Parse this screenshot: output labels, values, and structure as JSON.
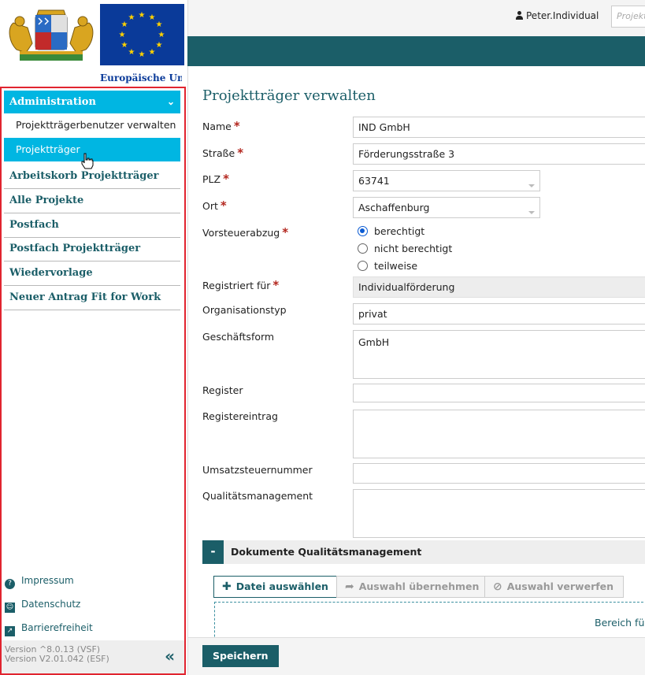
{
  "logos": {
    "eu_label": "Europäische Uni"
  },
  "sidebar": {
    "section_title": "Administration",
    "sub_items": [
      {
        "label": "Projektträgerbenutzer verwalten"
      },
      {
        "label": "Projektträger",
        "active": true
      }
    ],
    "items": [
      {
        "label": "Arbeitskorb Projektträger"
      },
      {
        "label": "Alle Projekte"
      },
      {
        "label": "Postfach"
      },
      {
        "label": "Postfach Projektträger"
      },
      {
        "label": "Wiedervorlage"
      },
      {
        "label": "Neuer Antrag Fit for Work"
      }
    ],
    "footer_links": [
      {
        "label": "Impressum",
        "icon": "question-circle-icon"
      },
      {
        "label": "Datenschutz",
        "icon": "id-badge-icon"
      },
      {
        "label": "Barrierefreiheit",
        "icon": "accessibility-icon"
      }
    ],
    "version_line1": "Version ^8.0.13 (VSF)",
    "version_line2": "Version V2.01.042 (ESF)"
  },
  "header": {
    "username": "Peter.Individual",
    "search_placeholder": "Projekt"
  },
  "form": {
    "title": "Projektträger verwalten",
    "labels": {
      "name": "Name",
      "strasse": "Straße",
      "plz": "PLZ",
      "ort": "Ort",
      "vorsteuerabzug": "Vorsteuerabzug",
      "registriert_fuer": "Registriert für",
      "organisationstyp": "Organisationstyp",
      "geschaeftsform": "Geschäftsform",
      "register": "Register",
      "registereintrag": "Registereintrag",
      "umsatzsteuernummer": "Umsatzsteuernummer",
      "qualitaetsmanagement": "Qualitätsmanagement"
    },
    "required_mark": "*",
    "values": {
      "name": "IND GmbH",
      "strasse": "Förderungsstraße 3",
      "plz": "63741",
      "ort": "Aschaffenburg",
      "registriert_fuer": "Individualförderung",
      "organisationstyp": "privat",
      "geschaeftsform": "GmbH",
      "register": "",
      "registereintrag": "",
      "umsatzsteuernummer": "",
      "qualitaetsmanagement": ""
    },
    "vorsteuer_options": [
      "berechtigt",
      "nicht berechtigt",
      "teilweise"
    ],
    "vorsteuer_selected": "berechtigt"
  },
  "documents": {
    "section_title": "Dokumente Qualitätsmanagement",
    "toggle_label": "-",
    "select_file": "Datei auswählen",
    "apply_selection": "Auswahl übernehmen",
    "discard_selection": "Auswahl verwerfen",
    "dropzone_text": "Bereich für"
  },
  "footer": {
    "save_label": "Speichern"
  },
  "colors": {
    "accent": "#00b6e2",
    "teal": "#1b5e68",
    "required": "#b3261e",
    "highlight_frame": "#e1242f"
  }
}
